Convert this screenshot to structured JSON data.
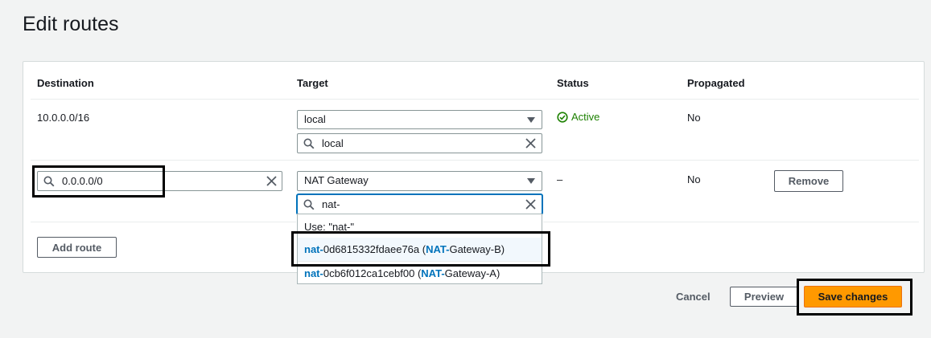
{
  "page": {
    "title": "Edit routes"
  },
  "columns": {
    "destination": "Destination",
    "target": "Target",
    "status": "Status",
    "propagated": "Propagated"
  },
  "rows": [
    {
      "destination": "10.0.0.0/16",
      "target_type": "local",
      "target_search": "local",
      "status": "Active",
      "propagated": "No"
    },
    {
      "destination": "0.0.0.0/0",
      "target_type": "NAT Gateway",
      "target_search": "nat-",
      "status": "–",
      "propagated": "No",
      "remove_label": "Remove"
    }
  ],
  "dropdown": {
    "use_option": "Use: \"nat-\"",
    "options": [
      {
        "pre": "nat-",
        "id": "0d6815332fdaee76a",
        "open": " (",
        "name_hl": "NAT-",
        "name_rest": "Gateway-B",
        "close": ")"
      },
      {
        "pre": "nat-",
        "id": "0cb6f012ca1cebf00",
        "open": " (",
        "name_hl": "NAT-",
        "name_rest": "Gateway-A",
        "close": ")"
      }
    ]
  },
  "actions": {
    "add_route": "Add route",
    "cancel": "Cancel",
    "preview": "Preview",
    "save": "Save changes"
  },
  "colors": {
    "primary": "#ff9900",
    "active": "#1d8102",
    "link_highlight": "#0073bb"
  }
}
